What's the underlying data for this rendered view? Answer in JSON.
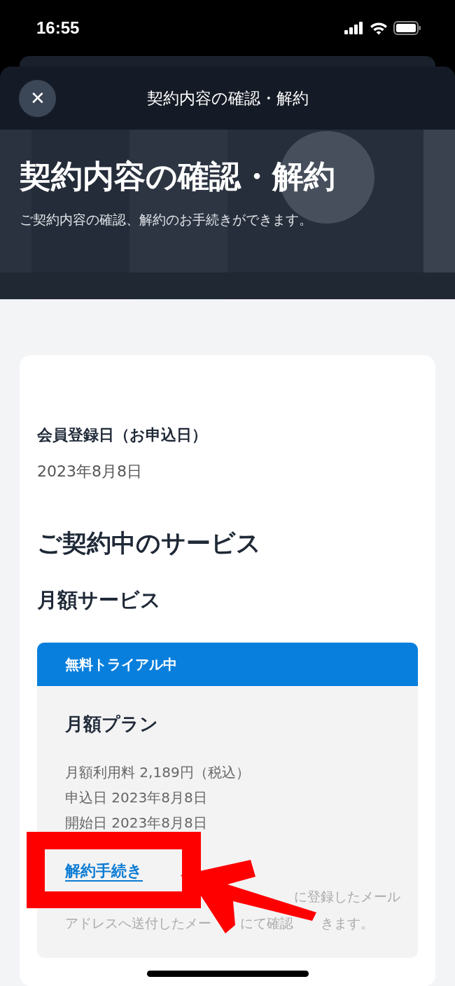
{
  "status_bar": {
    "time": "16:55"
  },
  "header": {
    "close_icon": "✕",
    "title": "契約内容の確認・解約"
  },
  "hero": {
    "title": "契約内容の確認・解約",
    "subtitle": "ご契約内容の確認、解約のお手続きができます。"
  },
  "registration": {
    "label": "会員登録日（お申込日）",
    "value": "2023年8月8日"
  },
  "services": {
    "heading": "ご契約中のサービス",
    "subheading": "月額サービス",
    "plan": {
      "badge": "無料トライアル中",
      "name": "月額プラン",
      "details": [
        "月額利用料 2,189円（税込）",
        "申込日 2023年8月8日",
        "開始日 2023年8月8日"
      ],
      "cancel_link": "解約手続き",
      "note_lines": [
        [
          "に登録したメール"
        ],
        [
          "アドレスへ送付したメー",
          "にて確認",
          "きます。"
        ]
      ]
    }
  }
}
